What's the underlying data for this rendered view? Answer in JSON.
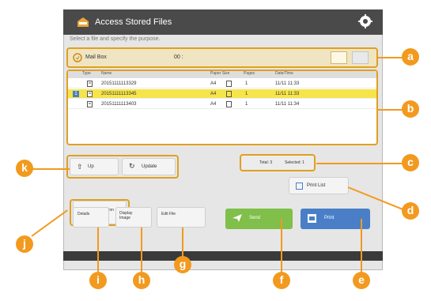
{
  "window": {
    "title": "Access Stored Files",
    "subtitle": "Select a file and specify the purpose."
  },
  "mailbox": {
    "label": "Mail Box",
    "number": "00 :"
  },
  "table": {
    "headers": [
      "Type",
      "Name",
      "Paper Size",
      "Pages",
      "Date/Time"
    ],
    "rows": [
      {
        "name": "20151111113329",
        "size": "A4",
        "pages": "1",
        "time": "11/11 11:33",
        "selected": false
      },
      {
        "name": "20151111113345",
        "size": "A4",
        "pages": "1",
        "time": "11/11 11:33",
        "selected": true,
        "check": "1"
      },
      {
        "name": "20151111113403",
        "size": "A4",
        "pages": "1",
        "time": "11/11 11:34",
        "selected": false
      }
    ]
  },
  "buttons": {
    "up": "Up",
    "update": "Update",
    "print_list": "Print List",
    "clear": "Clear Selection",
    "details": "Details",
    "display_image": "Display Image",
    "edit_file": "Edit File",
    "send": "Send",
    "print": "Print"
  },
  "status": {
    "total": "Total: 3",
    "selected": "Selected: 1"
  },
  "callouts": [
    "a",
    "b",
    "c",
    "d",
    "e",
    "f",
    "g",
    "h",
    "i",
    "j",
    "k"
  ],
  "colors": {
    "accent": "#e0a020",
    "callout": "#f29a1f",
    "send": "#7fbf4a",
    "print": "#4a7fc8",
    "selected_row": "#f6e54a"
  }
}
